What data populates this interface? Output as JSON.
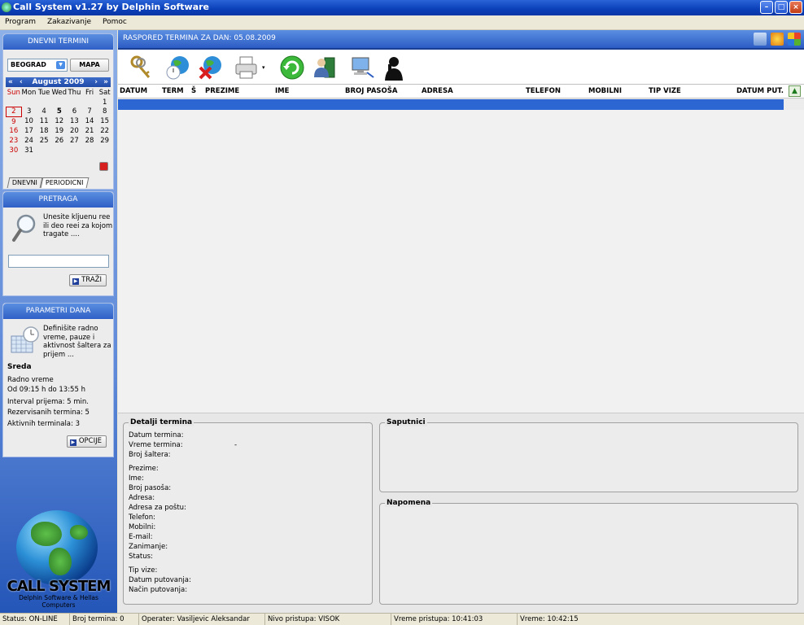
{
  "window": {
    "title": "Call System v1.27 by Delphin Software"
  },
  "menu": [
    "Program",
    "Zakazivanje",
    "Pomoc"
  ],
  "sidebar": {
    "dnevni": {
      "title": "DNEVNI TERMINI",
      "city": "BEOGRAD",
      "map_button": "MAPA",
      "month": "August 2009",
      "weekdays": [
        "Sun",
        "Mon",
        "Tue",
        "Wed",
        "Thu",
        "Fri",
        "Sat"
      ],
      "weeks": [
        [
          "",
          "",
          "",
          "",
          "",
          "",
          "1"
        ],
        [
          "2",
          "3",
          "4",
          "5",
          "6",
          "7",
          "8"
        ],
        [
          "9",
          "10",
          "11",
          "12",
          "13",
          "14",
          "15"
        ],
        [
          "16",
          "17",
          "18",
          "19",
          "20",
          "21",
          "22"
        ],
        [
          "23",
          "24",
          "25",
          "26",
          "27",
          "28",
          "29"
        ],
        [
          "30",
          "31",
          "",
          "",
          "",
          "",
          ""
        ]
      ],
      "tabs": [
        "DNEVNI",
        "PERIODICNI"
      ]
    },
    "pretraga": {
      "title": "PRETRAGA",
      "text": "Unesite kljuenu ree ili deo reei za kojom tragate ....",
      "input_value": "",
      "button": "TRAŽI"
    },
    "parametri": {
      "title": "PARAMETRI DANA",
      "text": "Definišite radno vreme, pauze i aktivnost šaltera za prijem ...",
      "day": "Sreda",
      "radno_label": "Radno vreme",
      "hours": "Od 09:15 h do 13:55 h",
      "interval": "Interval prijema: 5 min.",
      "reserved": "Rezervisanih termina: 5",
      "active": "Aktivnih terminala: 3",
      "button": "OPCIJE"
    },
    "logo": {
      "brand": "CALL SYSTEM",
      "sub": "Delphin Software & Hellas Computers"
    }
  },
  "main": {
    "header": "RASPORED TERMINA ZA DAN: 05.08.2009",
    "columns": [
      "DATUM",
      "TERM",
      "Š",
      "PREZIME",
      "IME",
      "BROJ PASOŠA",
      "ADRESA",
      "TELEFON",
      "MOBILNI",
      "TIP VIZE",
      "DATUM PUT."
    ]
  },
  "details": {
    "title": "Detalji termina",
    "fields": [
      "Datum termina:",
      "Vreme termina:",
      "Broj šaltera:",
      "Prezime:",
      "Ime:",
      "Broj pasoša:",
      "Adresa:",
      "Adresa za poštu:",
      "Telefon:",
      "Mobilni:",
      "E-mail:",
      "Zanimanje:",
      "Status:",
      "Tip vize:",
      "Datum putovanja:",
      "Način putovanja:"
    ],
    "time_value": "-",
    "saputnici": "Saputnici",
    "napomena": "Napomena"
  },
  "statusbar": [
    "Status: ON-LINE",
    "Broj termina: 0",
    "Operater: Vasiljevic Aleksandar",
    "Nivo pristupa: VISOK",
    "Vreme pristupa: 10:41:03",
    "Vreme: 10:42:15"
  ],
  "colors": {
    "header_blue": "#2c5cc4",
    "selection": "#2c66d2",
    "sunday_red": "#cc0000"
  },
  "icons": [
    "keys-icon",
    "globe-calendar-icon",
    "globe-delete-icon",
    "printer-icon",
    "refresh-icon",
    "user-book-icon",
    "computer-network-icon",
    "phone-person-icon"
  ]
}
